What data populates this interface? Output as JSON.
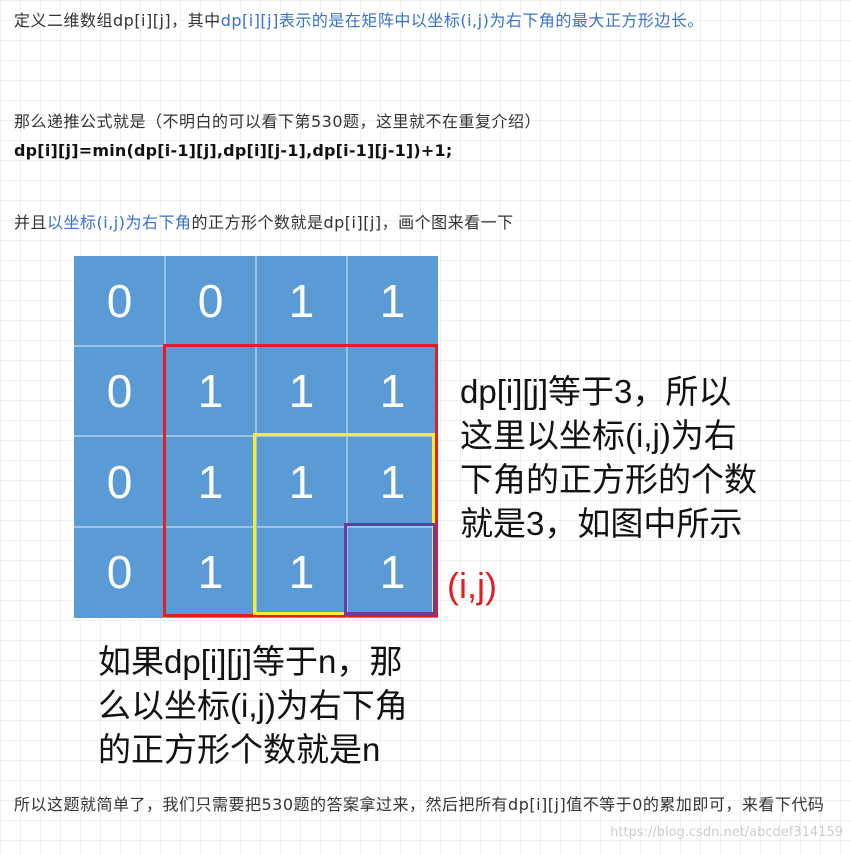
{
  "para1": {
    "a": "定义二维数组dp[i][j]，其中",
    "b": "dp[i][j]表示的是在矩阵中以坐标(i,j)为右下角的最大正方形边长。"
  },
  "para2": "那么递推公式就是（不明白的可以看下第530题，这里就不在重复介绍）",
  "formula": "dp[i][j]=min(dp[i-1][j],dp[i][j-1],dp[i-1][j-1])+1;",
  "para3": {
    "a": "并且",
    "b": "以坐标(i,j)为右下角",
    "c": "的正方形个数就是dp[i][j]，画个图来看一下"
  },
  "figure": {
    "matrix": [
      [
        "0",
        "0",
        "1",
        "1"
      ],
      [
        "0",
        "1",
        "1",
        "1"
      ],
      [
        "0",
        "1",
        "1",
        "1"
      ],
      [
        "0",
        "1",
        "1",
        "1"
      ]
    ],
    "right_note_lines": [
      "dp[i][j]等于3，所以",
      "这里以坐标(i,j)为右",
      "下角的正方形的个数",
      "就是3，如图中所示"
    ],
    "ij_label": "(i,j)",
    "bottom_note_lines": [
      "如果dp[i][j]等于n，那",
      "么以坐标(i,j)为右下角",
      "的正方形个数就是n"
    ],
    "colors": {
      "cell": "#5b9bd5",
      "red": "#e02020",
      "yellow": "#f5ef2b",
      "purple": "#6a3aa8"
    }
  },
  "para4": "所以这题就简单了，我们只需要把530题的答案拿过来，然后把所有dp[i][j]值不等于0的累加即可，来看下代码",
  "watermark": "https://blog.csdn.net/abcdef314159"
}
